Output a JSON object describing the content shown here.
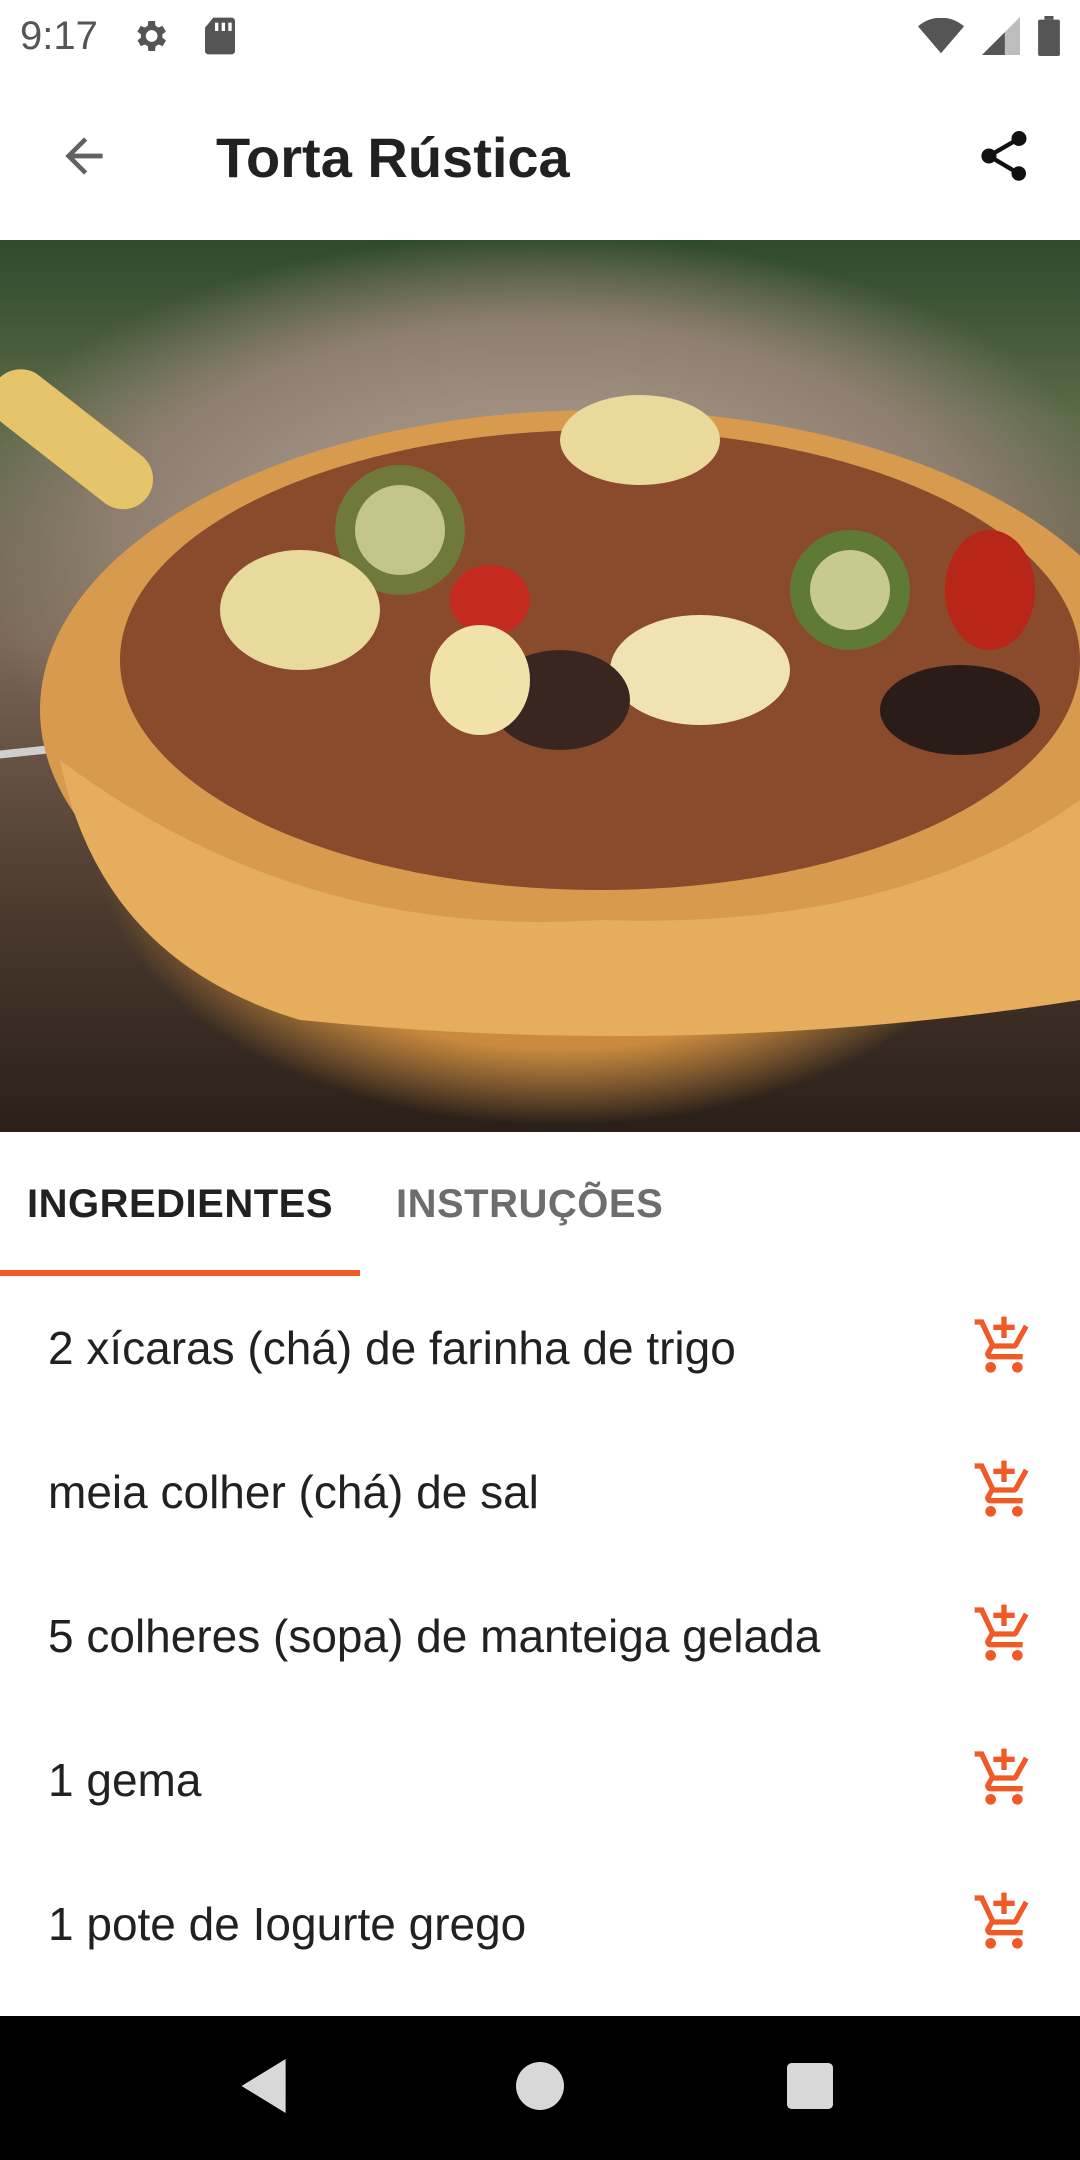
{
  "status_bar": {
    "time": "9:17",
    "icons_left": [
      "gear-icon",
      "sd-card-icon"
    ],
    "icons_right": [
      "wifi-icon",
      "signal-icon",
      "battery-icon"
    ]
  },
  "toolbar": {
    "title": "Torta Rústica",
    "back_icon": "arrow-back-icon",
    "share_icon": "share-icon"
  },
  "hero_image": {
    "description_icon": "recipe-photo"
  },
  "tabs": [
    {
      "label": "INGREDIENTES",
      "active": true
    },
    {
      "label": "INSTRUÇÕES",
      "active": false
    }
  ],
  "ingredients": [
    {
      "text": "2 xícaras (chá) de farinha de trigo"
    },
    {
      "text": "meia colher (chá) de sal"
    },
    {
      "text": "5 colheres (sopa) de manteiga gelada"
    },
    {
      "text": "1 gema"
    },
    {
      "text": "1 pote de Iogurte grego"
    }
  ],
  "colors": {
    "accent": "#f05a28",
    "text": "#212121",
    "inactive_tab": "#6d6d6d"
  },
  "nav_bar": {
    "icons": [
      "back-triangle-icon",
      "home-circle-icon",
      "recents-square-icon"
    ]
  }
}
